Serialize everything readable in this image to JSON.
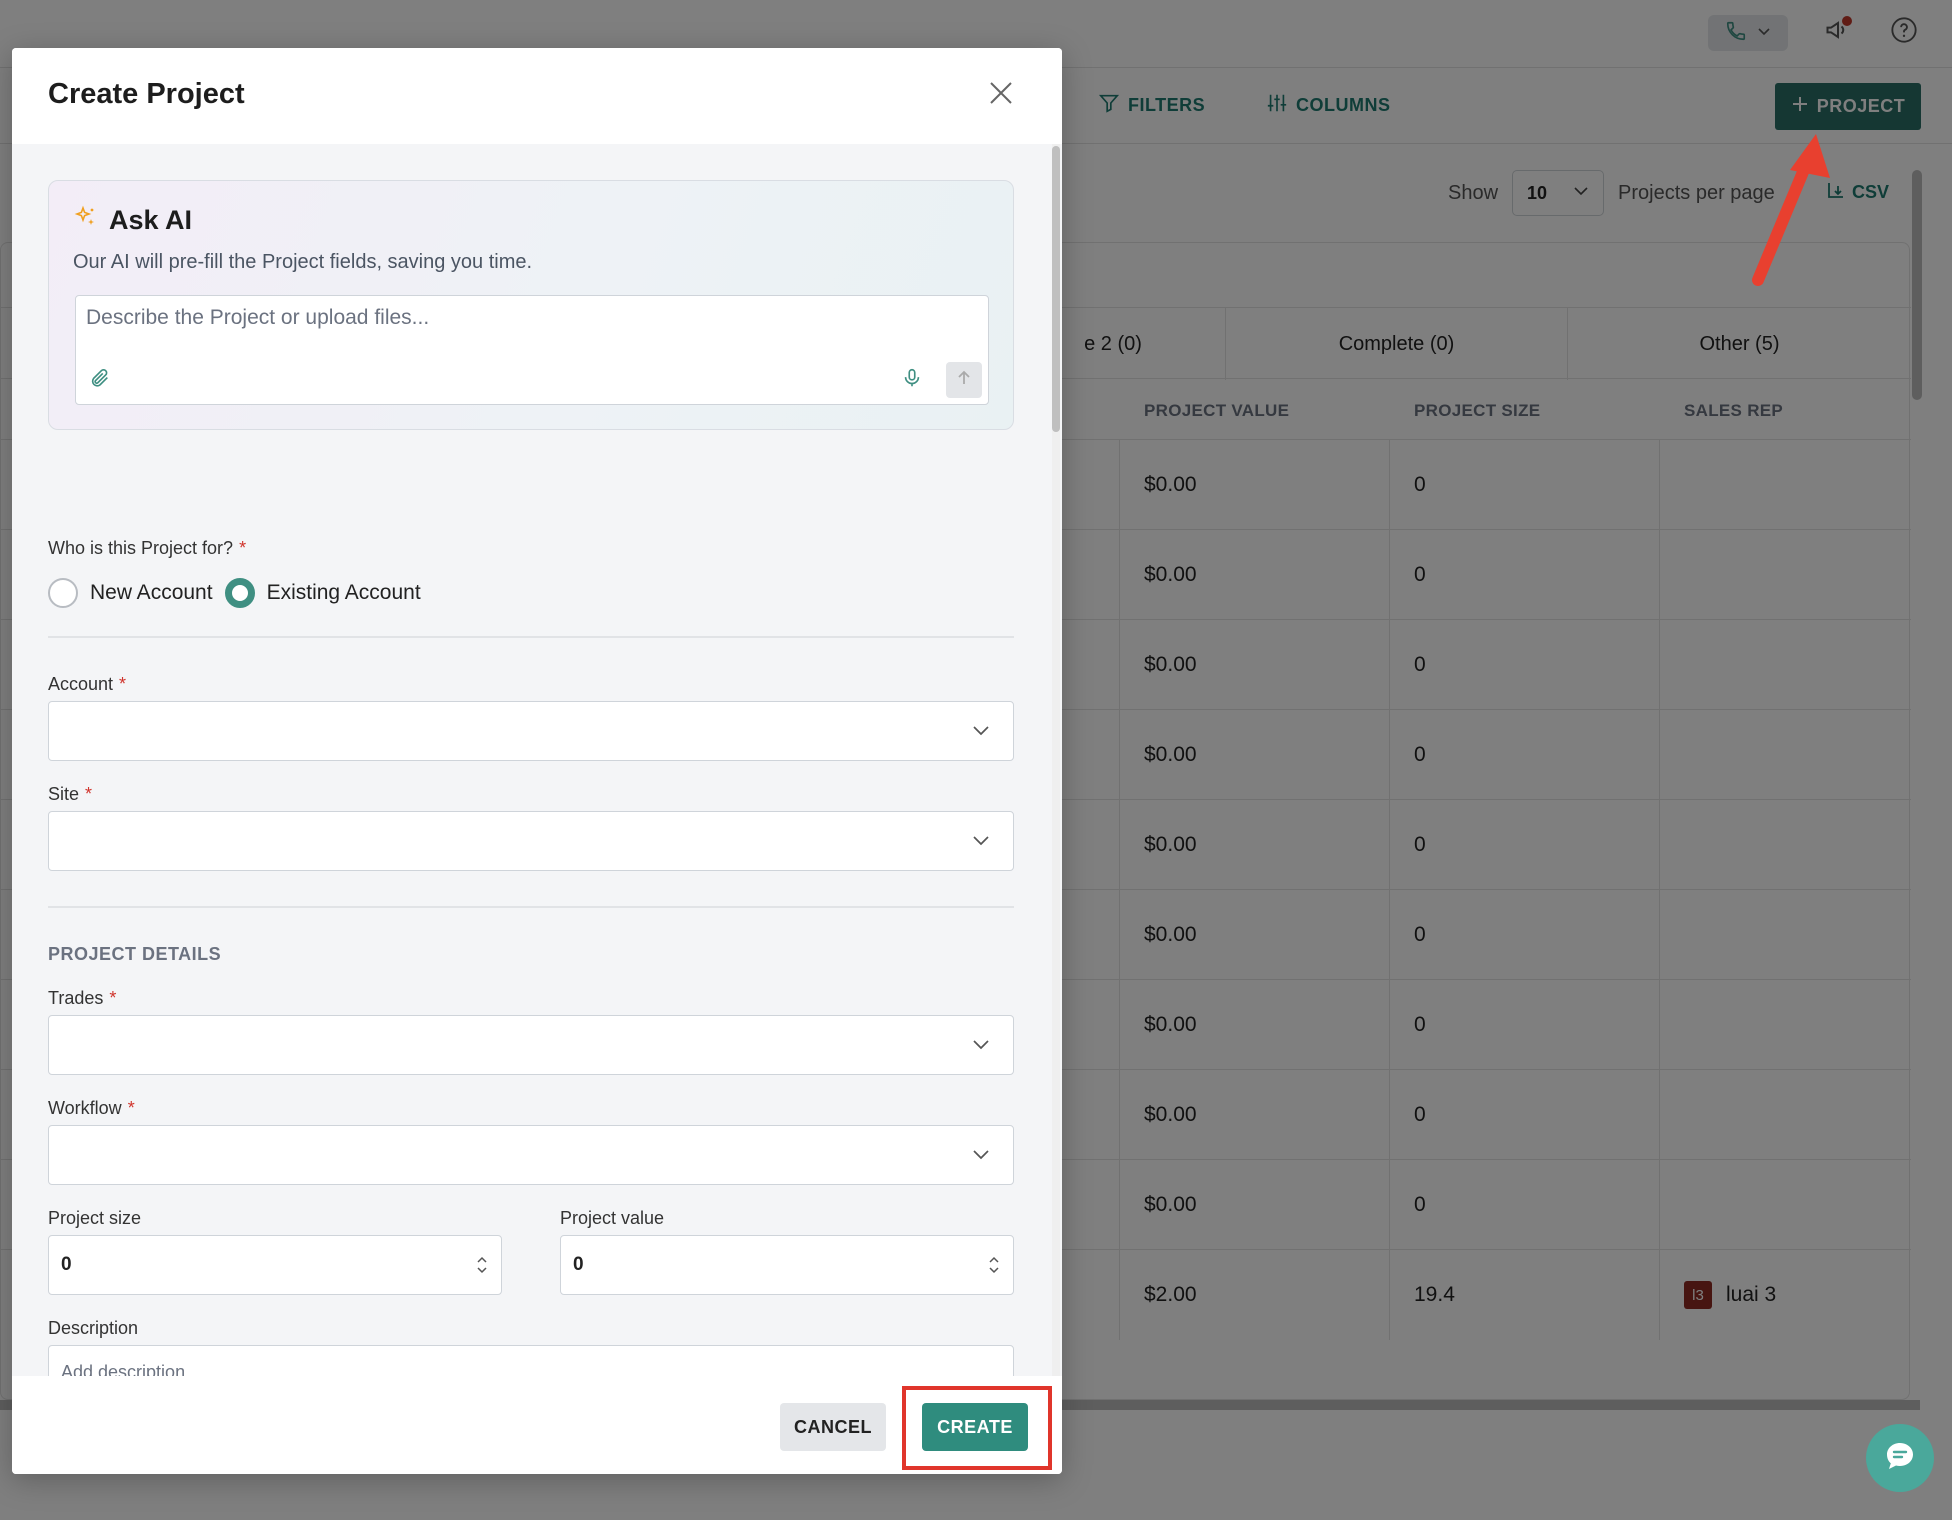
{
  "toolbar": {
    "filters_label": "FILTERS",
    "columns_label": "COLUMNS",
    "add_project_label": "PROJECT"
  },
  "pagination": {
    "show_label": "Show",
    "per_page_value": "10",
    "per_page_label": "Projects per page",
    "csv_label": "CSV"
  },
  "stage_tabs": [
    {
      "label": "e 2 (0)"
    },
    {
      "label": "Complete (0)"
    },
    {
      "label": "Other (5)"
    }
  ],
  "table": {
    "columns": [
      "PROJECT VALUE",
      "PROJECT SIZE",
      "SALES REP"
    ],
    "rows": [
      {
        "value": "$0.00",
        "size": "0",
        "rep": ""
      },
      {
        "value": "$0.00",
        "size": "0",
        "rep": ""
      },
      {
        "value": "$0.00",
        "size": "0",
        "rep": ""
      },
      {
        "value": "$0.00",
        "size": "0",
        "rep": ""
      },
      {
        "value": "$0.00",
        "size": "0",
        "rep": ""
      },
      {
        "value": "$0.00",
        "size": "0",
        "rep": ""
      },
      {
        "value": "$0.00",
        "size": "0",
        "rep": ""
      },
      {
        "value": "$0.00",
        "size": "0",
        "rep": ""
      },
      {
        "value": "$0.00",
        "size": "0",
        "rep": ""
      },
      {
        "value": "$2.00",
        "size": "19.4",
        "rep": "luai 3",
        "rep_initials": "l3"
      }
    ]
  },
  "modal": {
    "title": "Create Project",
    "ask_ai": {
      "title": "Ask AI",
      "subtitle": "Our AI will pre-fill the Project fields, saving you time.",
      "placeholder": "Describe the Project or upload files..."
    },
    "who_for": {
      "label": "Who is this Project for?",
      "required": "*",
      "options": [
        {
          "label": "New Account",
          "checked": false
        },
        {
          "label": "Existing Account",
          "checked": true
        }
      ]
    },
    "account": {
      "label": "Account",
      "required": "*"
    },
    "site": {
      "label": "Site",
      "required": "*"
    },
    "section_title": "PROJECT DETAILS",
    "trades": {
      "label": "Trades",
      "required": "*"
    },
    "workflow": {
      "label": "Workflow",
      "required": "*"
    },
    "project_size": {
      "label": "Project size",
      "value": "0"
    },
    "project_value": {
      "label": "Project value",
      "value": "0"
    },
    "description": {
      "label": "Description",
      "placeholder": "Add description..."
    },
    "cancel_label": "CANCEL",
    "create_label": "CREATE"
  },
  "colors": {
    "accent": "#2f8c7e",
    "brand_dark": "#2a6f66",
    "highlight": "#e0352b",
    "required": "#d0342c"
  }
}
